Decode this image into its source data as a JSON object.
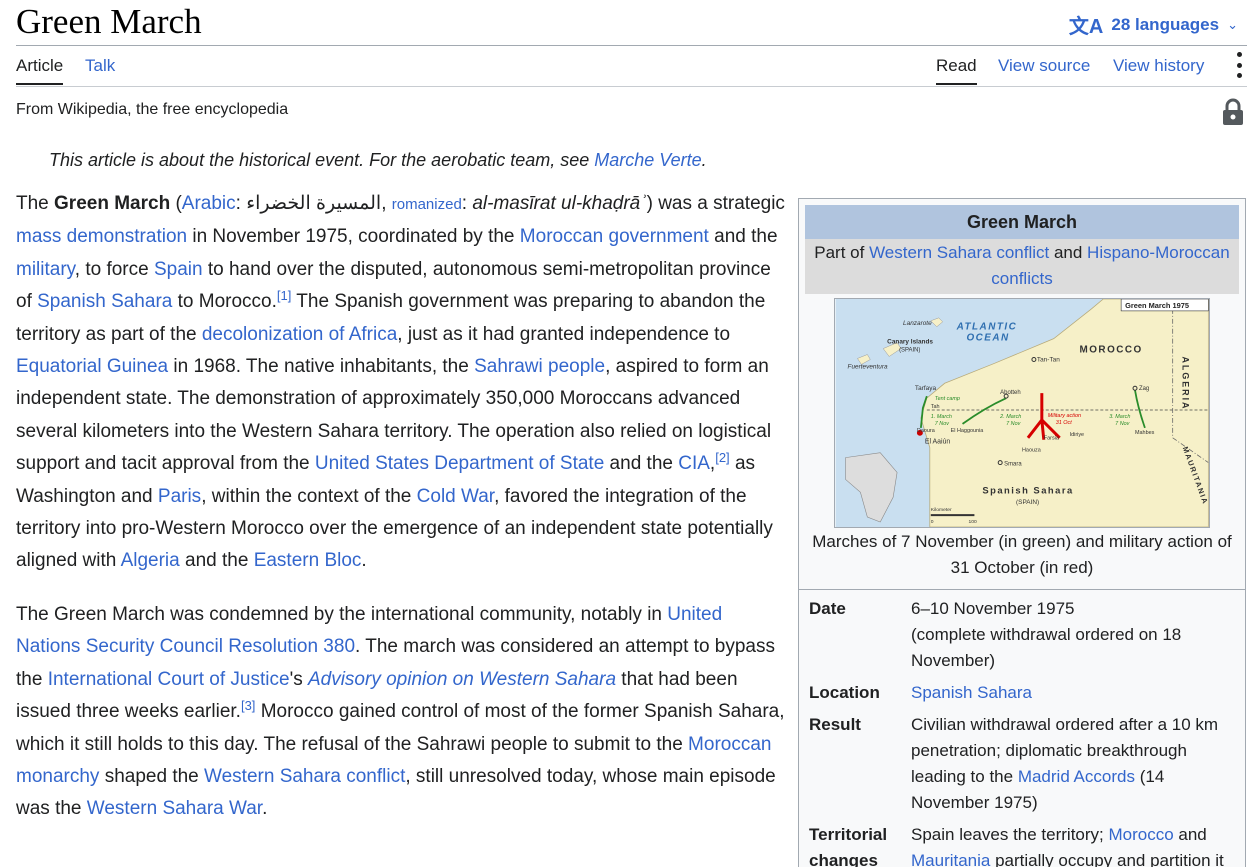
{
  "page": {
    "title": "Green March",
    "languages": "28 languages",
    "tabs": {
      "article": "Article",
      "talk": "Talk",
      "read": "Read",
      "view_source": "View source",
      "view_history": "View history"
    },
    "tagline": "From Wikipedia, the free encyclopedia",
    "icons": [
      "translate-icon",
      "chevron-down-icon",
      "more-menu-icon",
      "lock-icon"
    ]
  },
  "hatnote": {
    "before": "This article is about the historical event. For the aerobatic team, see ",
    "link": "Marche Verte",
    "after": "."
  },
  "para1": {
    "t1": "The ",
    "bold": "Green March",
    "t2": " (",
    "arabic_link": "Arabic",
    "t3": ": المسيرة الخضراء, ",
    "romanized_link": "romanized",
    "t4": ": ",
    "translit": "al-masīrat ul-khaḍrāʾ",
    "t5": ") was a strategic ",
    "l_mass": "mass demonstration",
    "t6": " in November 1975, coordinated by the ",
    "l_morgov": "Moroccan government",
    "t7": " and the ",
    "l_military": "military",
    "t8": ", to force ",
    "l_spain": "Spain",
    "t9": " to hand over the disputed, autonomous semi-metropolitan province of ",
    "l_sahara": "Spanish Sahara",
    "t10": " to Morocco.",
    "ref1": "[1]",
    "t11": " The Spanish government was preparing to abandon the territory as part of the ",
    "l_decol": "decolonization of Africa",
    "t12": ", just as it had granted independence to ",
    "l_eqguinea": "Equatorial Guinea",
    "t13": " in 1968. The native inhabitants, the ",
    "l_sahrawi": "Sahrawi people",
    "t14": ", aspired to form an independent state. The demonstration of approximately 350,000 Moroccans advanced several kilometers into the Western Sahara territory. The operation also relied on logistical support and tacit approval from the ",
    "l_usdos": "United States Department of State",
    "t15": " and the ",
    "l_cia": "CIA",
    "t16": ",",
    "ref2": "[2]",
    "t17": " as Washington and ",
    "l_paris": "Paris",
    "t18": ", within the context of the ",
    "l_coldwar": "Cold War",
    "t19": ", favored the integration of the territory into pro-Western Morocco over the emergence of an independent state potentially aligned with ",
    "l_algeria": "Algeria",
    "t20": " and the ",
    "l_eastbloc": "Eastern Bloc",
    "t21": "."
  },
  "para2": {
    "t1": "The Green March was condemned by the international community, notably in ",
    "l_unsc": "United Nations Security Council Resolution 380",
    "t2": ". The march was considered an attempt to bypass the ",
    "l_icj": "International Court of Justice",
    "t3": "'s ",
    "l_advisory": "Advisory opinion on Western Sahara",
    "t4": " that had been issued three weeks earlier.",
    "ref3": "[3]",
    "t5": " Morocco gained control of most of the former Spanish Sahara, which it still holds to this day. The refusal of the Sahrawi people to submit to the ",
    "l_monarchy": "Moroccan monarchy",
    "t6": " shaped the ",
    "l_wsconflict": "Western Sahara conflict",
    "t7": ", still unresolved today, whose main episode was the ",
    "l_wswar": "Western Sahara War",
    "t8": "."
  },
  "infobox": {
    "title": "Green March",
    "partof": {
      "t1": "Part of ",
      "l1": "Western Sahara conflict",
      "t2": " and ",
      "l2": "Hispano-Moroccan conflicts"
    },
    "map": {
      "title": "Green March 1975",
      "ocean1": "ATLANTIC",
      "ocean2": "OCEAN",
      "morocco": "MOROCCO",
      "algeria": "ALGERIA",
      "mauritania": "MAURITANIA",
      "sahara1": "Spanish Sahara",
      "sahara2": "(SPAIN)",
      "lanzarote": "Lanzarote",
      "canary1": "Canary Islands",
      "canary2": "(SPAIN)",
      "fuerteventura": "Fuerteventura",
      "tantan": "Tan-Tan",
      "tarfaya": "Tarfaya",
      "tent": "Tent camp",
      "tah": "Tah",
      "abotteh": "Abotteh",
      "zag": "Zag",
      "march1a": "1. March",
      "march1b": "7 Nov",
      "march2a": "2. March",
      "march2b": "7 Nov",
      "march3a": "3. March",
      "march3b": "7 Nov",
      "mil1": "Military action",
      "mil2": "31 Oct",
      "daoura": "Daoura",
      "elhagounia": "El Haggounia",
      "farsia": "Farsia",
      "idiriye": "Idiriye",
      "haouza": "Haouza",
      "mahbes": "Mahbes",
      "elaaiun": "El Aaiún",
      "smara": "Smara",
      "km": "Kilometer",
      "km0": "0",
      "km100": "100"
    },
    "caption": "Marches of 7 November (in green) and military action of 31 October (in red)",
    "rows": {
      "date_label": "Date",
      "date_value": "6–10 November 1975",
      "date_note": "(complete withdrawal ordered on 18 November)",
      "location_label": "Location",
      "location_value": "Spanish Sahara",
      "result_label": "Result",
      "result_t1": "Civilian withdrawal ordered after a 10 km penetration; diplomatic breakthrough leading to the ",
      "result_link": "Madrid Accords",
      "result_t2": " (14 November 1975)",
      "terr_label": "Territorial changes",
      "terr_t1": "Spain leaves the territory; ",
      "terr_l1": "Morocco",
      "terr_t2": " and ",
      "terr_l2": "Mauritania",
      "terr_t3": " partially occupy and partition it"
    }
  }
}
